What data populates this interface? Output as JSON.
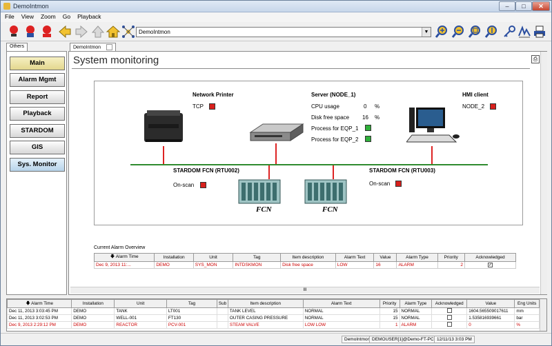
{
  "window": {
    "title": "DemoIntmon"
  },
  "menu": [
    "File",
    "View",
    "Zoom",
    "Go",
    "Playback"
  ],
  "toolbar": {
    "address_value": "DemoIntmon"
  },
  "left_tabs": [
    "Others"
  ],
  "nav": [
    "Main",
    "Alarm Mgmt",
    "Report",
    "Playback",
    "STARDOM",
    "GIS",
    "Sys. Monitor"
  ],
  "doc_tab": "DemoIntmon",
  "page": {
    "heading": "System monitoring"
  },
  "diagram": {
    "printer": {
      "title": "Network Printer",
      "status_label": "TCP"
    },
    "server": {
      "title": "Server (NODE_1)",
      "cpu_label": "CPU usage",
      "cpu_value": "0",
      "cpu_unit": "%",
      "disk_label": "Disk free space",
      "disk_value": "16",
      "disk_unit": "%",
      "proc1": "Process for EQP_1",
      "proc2": "Process for EQP_2"
    },
    "hmi": {
      "title": "HMI client",
      "status_label": "NODE_2"
    },
    "fcn1": {
      "title": "STARDOM FCN (RTU002)",
      "status_label": "On-scan"
    },
    "fcn2": {
      "title": "STARDOM FCN (RTU003)",
      "status_label": "On-scan"
    },
    "fcn_logo": "FCN",
    "colors": {
      "bus": "#2e8b2e",
      "drop": "#d22222",
      "status_red": "#d8201c",
      "status_green": "#2fb03a"
    }
  },
  "current_alarms": {
    "title": "Current Alarm Overview",
    "columns": [
      "Alarm Time",
      "Installation",
      "Unit",
      "Tag",
      "Item description",
      "Alarm Text",
      "Value",
      "Alarm Type",
      "Priority",
      "Acknowledged"
    ],
    "rows": [
      [
        "Dec 9, 2013 11:...",
        "DEMO",
        "SYS_MON",
        "INTDSKMON",
        "Disk free space",
        "LOW",
        "16",
        "ALARM",
        "2",
        "✓"
      ]
    ]
  },
  "alarm_list": {
    "columns": [
      "Alarm Time",
      "Installation",
      "Unit",
      "Tag",
      "Sub",
      "Item description",
      "Alarm Text",
      "Priority",
      "Alarm Type",
      "Acknowledged",
      "Value",
      "Eng Units"
    ],
    "rows": [
      [
        "Dec 11, 2013 3:03:45 PM",
        "DEMO",
        "TANK",
        "LT001",
        "",
        "TANK LEVEL",
        "NORMAL",
        "15",
        "NORMAL",
        "",
        "1604.565509017611",
        "mm"
      ],
      [
        "Dec 11, 2013 3:02:53 PM",
        "DEMO",
        "WELL-001",
        "FT130",
        "",
        "OUTER CASING PRESSURE",
        "NORMAL",
        "15",
        "NORMAL",
        "",
        "1.535816939661",
        "bar"
      ],
      [
        "Dec 9, 2013 2:29:12 PM",
        "DEMO",
        "REACTOR",
        "PCV-001",
        "",
        "STEAM VALVE",
        "LOW LOW",
        "1",
        "ALARM",
        "",
        "0",
        "%"
      ]
    ]
  },
  "status": [
    "DemoIntmon",
    "DEMOUSER[1]@Demo-FT-PC",
    "12/11/13 3:03 PM"
  ]
}
